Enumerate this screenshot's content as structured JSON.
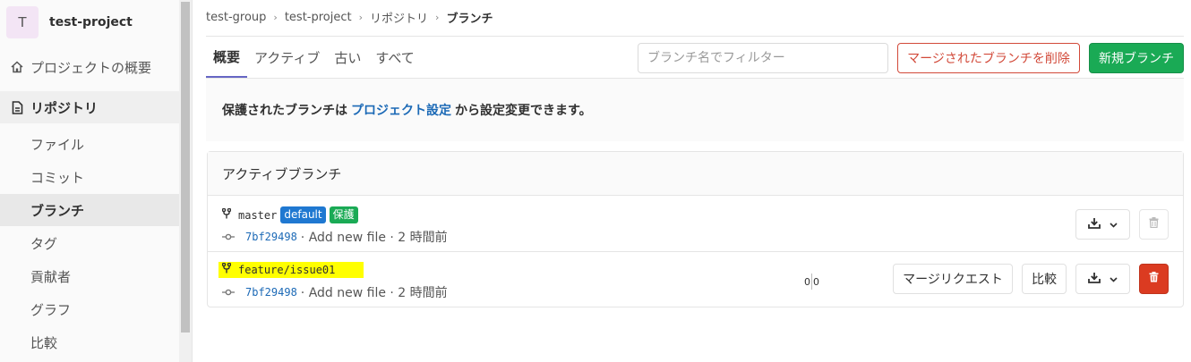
{
  "project": {
    "avatar_letter": "T",
    "name": "test-project"
  },
  "sidebar": {
    "overview_label": "プロジェクトの概要",
    "repository_label": "リポジトリ",
    "sub_items": [
      "ファイル",
      "コミット",
      "ブランチ",
      "タグ",
      "貢献者",
      "グラフ",
      "比較"
    ],
    "current_item": "ブランチ"
  },
  "breadcrumb": [
    "test-group",
    "test-project",
    "リポジトリ",
    "ブランチ"
  ],
  "tabs": [
    "概要",
    "アクティブ",
    "古い",
    "すべて"
  ],
  "active_tab": "概要",
  "filter": {
    "placeholder": "ブランチ名でフィルター"
  },
  "buttons": {
    "delete_merged": "マージされたブランチを削除",
    "new_branch": "新規ブランチ"
  },
  "notice": {
    "prefix": "保護されたブランチは",
    "link": "プロジェクト設定",
    "suffix": "から設定変更できます。"
  },
  "panel": {
    "title": "アクティブブランチ",
    "branches": [
      {
        "name": "master",
        "badges": [
          "default",
          "保護"
        ],
        "sha": "7bf29498",
        "commit_text": "· Add new file · 2 時間前"
      },
      {
        "name": "feature/issue01",
        "badges": [],
        "sha": "7bf29498",
        "commit_text": "· Add new file · 2 時間前",
        "behind": "0",
        "ahead": "0",
        "merge_request_label": "マージリクエスト",
        "compare_label": "比較"
      }
    ]
  },
  "colors": {
    "accent_green": "#1aaa55",
    "danger_red": "#db3b21",
    "link_blue": "#1b69b6",
    "highlight": "#ffff00"
  }
}
